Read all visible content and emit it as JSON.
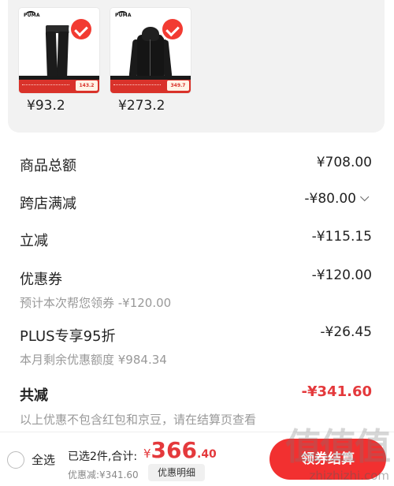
{
  "colors": {
    "accent": "#e4393c",
    "checkout": "#f23030",
    "panel": "#f2f2f2"
  },
  "products": [
    {
      "brand": "PUMA",
      "price": "¥93.2",
      "promo_price": "143.2",
      "icon": "pants-image"
    },
    {
      "brand": "PUMA",
      "price": "¥273.2",
      "promo_price": "349.7",
      "icon": "jacket-image"
    }
  ],
  "summary": {
    "goods_total_label": "商品总额",
    "goods_total_value": "¥708.00",
    "cross_store_label": "跨店满减",
    "cross_store_value": "-¥80.00",
    "instant_label": "立减",
    "instant_value": "-¥115.15",
    "coupon_label": "优惠券",
    "coupon_value": "-¥120.00",
    "coupon_sub": "预计本次帮您领券 -¥120.00",
    "plus_label": "PLUS专享95折",
    "plus_value": "-¥26.45",
    "plus_sub": "本月剩余优惠额度 ¥984.34",
    "total_discount_label": "共减",
    "total_discount_value": "-¥341.60",
    "note": "以上优惠不包含红包和京豆，请在结算页查看"
  },
  "bottom": {
    "select_all": "全选",
    "selected_count": "已选2件,合计:",
    "currency": "¥",
    "total_int": "366",
    "total_dec": ".40",
    "discount_line": "优惠减:¥341.60",
    "detail_button": "优惠明细",
    "checkout_button": "领券结算"
  },
  "watermark": {
    "text": "值值值",
    "url": "zhizhizhi.com"
  }
}
